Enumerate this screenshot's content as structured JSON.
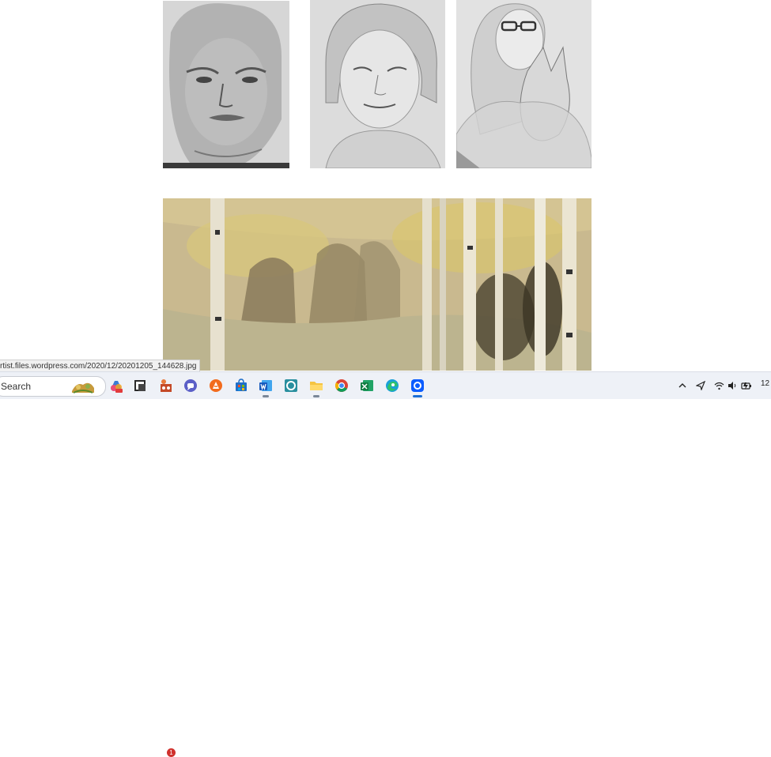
{
  "status_bar": {
    "url": "rtist.files.wordpress.com/2020/12/20201205_144628.jpg"
  },
  "taskbar": {
    "search_label": "Search",
    "notification_count": "1",
    "clock": "12"
  },
  "colors": {
    "taskbar_bg": "#eef1f7",
    "accent": "#1b6ed6"
  },
  "icons": [
    "sketch-portrait-man",
    "sketch-portrait-elderly-woman",
    "sketch-portrait-woman-with-cat",
    "watercolor-birch-forest",
    "copilot-icon",
    "notes-icon",
    "game-icon",
    "teams-chat-icon",
    "avast-icon",
    "microsoft-store-icon",
    "word-icon",
    "store-icon",
    "file-explorer-icon",
    "chrome-icon",
    "excel-icon",
    "edge-icon",
    "zoom-icon",
    "chevron-up-icon",
    "location-icon",
    "wifi-icon",
    "speaker-icon",
    "battery-icon"
  ]
}
